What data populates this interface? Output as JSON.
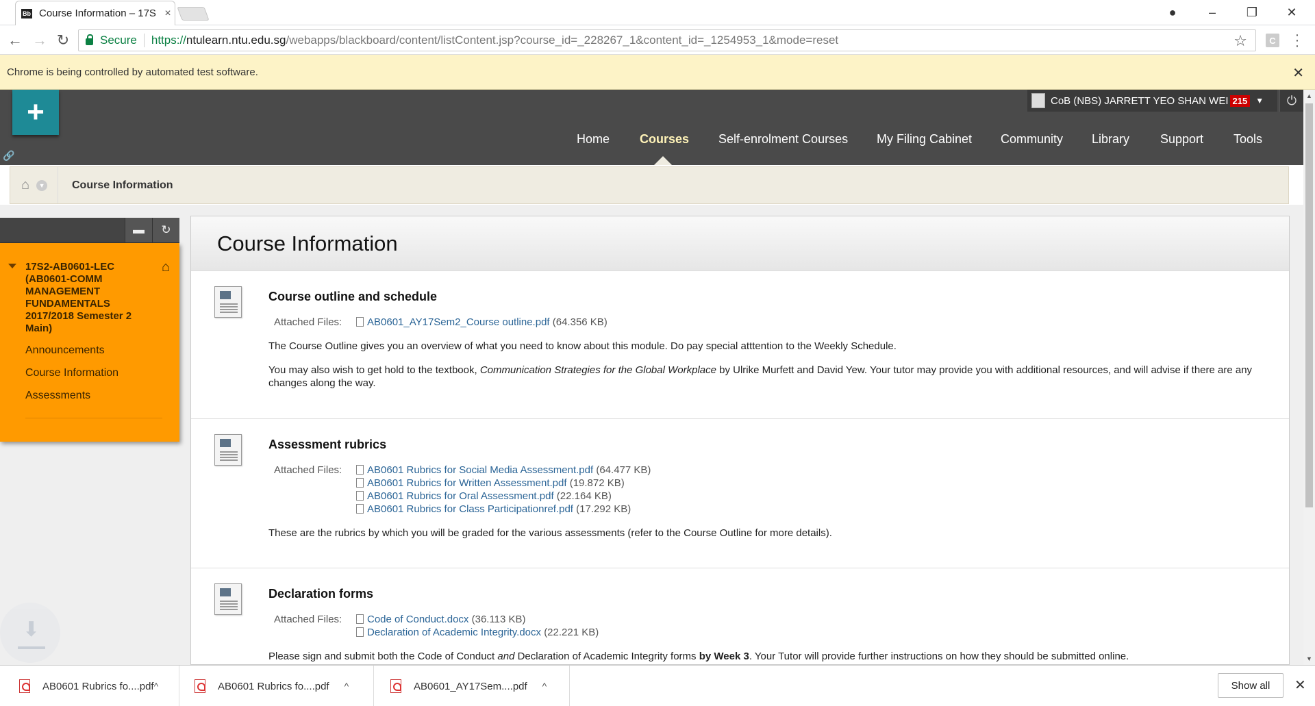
{
  "browser": {
    "tab_favicon": "Bb",
    "tab_title": "Course Information – 17S",
    "tab_close": "×",
    "secure_label": "Secure",
    "url_scheme": "https://",
    "url_host": "ntulearn.ntu.edu.sg",
    "url_path": "/webapps/blackboard/content/listContent.jsp?course_id=_228267_1&content_id=_1254953_1&mode=reset",
    "ext_letter": "C",
    "infobar_text": "Chrome is being controlled by automated test software."
  },
  "header": {
    "user_name": "CoB (NBS) JARRETT YEO SHAN WEI",
    "notification_count": "215",
    "nav": [
      "Home",
      "Courses",
      "Self-enrolment Courses",
      "My Filing Cabinet",
      "Community",
      "Library",
      "Support",
      "Tools"
    ],
    "active_nav": "Courses"
  },
  "breadcrumb": {
    "current": "Course Information"
  },
  "course_menu": {
    "course_title": "17S2-AB0601-LEC (AB0601-COMM MANAGEMENT FUNDAMENTALS 2017/2018 Semester 2 Main)",
    "links": [
      "Announcements",
      "Course Information",
      "Assessments"
    ]
  },
  "content": {
    "page_title": "Course Information",
    "attached_label": "Attached Files:",
    "items": [
      {
        "title": "Course outline and schedule",
        "files": [
          {
            "name": "AB0601_AY17Sem2_Course outline.pdf",
            "size": "(64.356 KB)"
          }
        ],
        "desc1": "The Course Outline gives you an overview of what you need to know about this module. Do pay special atttention to the Weekly Schedule.",
        "desc2_a": "You may also wish to get hold to the textbook, ",
        "desc2_italic": "Communication Strategies for the Global Workplace",
        "desc2_b": " by Ulrike Murfett and David Yew. Your tutor may provide you with additional resources, and will advise if there are any changes along the way."
      },
      {
        "title": "Assessment rubrics",
        "files": [
          {
            "name": "AB0601 Rubrics for Social Media Assessment.pdf",
            "size": "(64.477 KB)"
          },
          {
            "name": "AB0601 Rubrics for Written Assessment.pdf",
            "size": "(19.872 KB)"
          },
          {
            "name": "AB0601 Rubrics for Oral Assessment.pdf",
            "size": "(22.164 KB)"
          },
          {
            "name": "AB0601 Rubrics for Class Participationref.pdf",
            "size": "(17.292 KB)"
          }
        ],
        "desc1": "These are the rubrics by which you will be graded for the various assessments (refer to the Course Outline for more details)."
      },
      {
        "title": "Declaration forms",
        "files": [
          {
            "name": "Code of Conduct.docx",
            "size": "(36.113 KB)"
          },
          {
            "name": "Declaration of Academic Integrity.docx",
            "size": "(22.221 KB)"
          }
        ],
        "desc_a": "Please sign and submit both the Code of Conduct ",
        "desc_italic": "and",
        "desc_b": " Declaration of Academic Integrity forms ",
        "desc_bold": "by Week 3",
        "desc_c": ". Your Tutor will provide further instructions on how they should be submitted online."
      }
    ]
  },
  "downloads": {
    "items": [
      "AB0601 Rubrics fo....pdf",
      "AB0601 Rubrics fo....pdf",
      "AB0601_AY17Sem....pdf"
    ],
    "show_all": "Show all"
  },
  "colors": {
    "course_menu_bg": "#ff9a00",
    "header_bg": "#4a4a4a",
    "link": "#2a6496",
    "plus_tile": "#1e8a96"
  }
}
